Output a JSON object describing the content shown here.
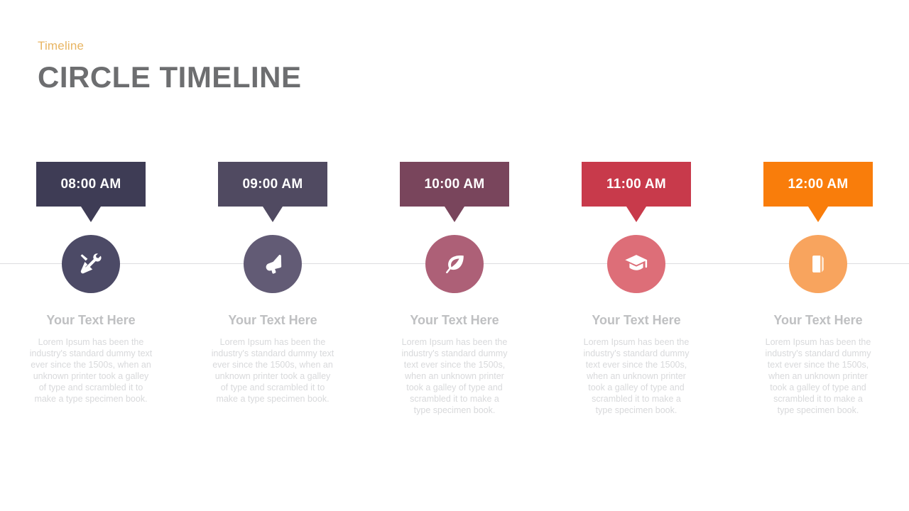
{
  "header": {
    "kicker": "Timeline",
    "title": "CIRCLE TIMELINE",
    "kicker_color": "#E8B563",
    "title_color": "#6D6E70"
  },
  "axis": {
    "color": "#DCDCDF"
  },
  "items": [
    {
      "time": "08:00 AM",
      "heading": "Your Text Here",
      "body": "Lorem Ipsum has been the industry's standard dummy text ever  since the 1500s, when  an  unknown printer took a galley of type and scrambled it to make a type specimen book.",
      "banner_color": "#3E3C55",
      "circle_color": "#4C4A66",
      "icon": "tools-icon"
    },
    {
      "time": "09:00 AM",
      "heading": "Your Text Here",
      "body": "Lorem Ipsum has been the industry's standard dummy text ever  since the 1500s, when  an  unknown printer took a galley of type and scrambled it to make a type specimen book.",
      "banner_color": "#504A61",
      "circle_color": "#625B75",
      "icon": "megaphone-icon"
    },
    {
      "time": "10:00 AM",
      "heading": "Your Text Here",
      "body": "Lorem Ipsum has been the industry's standard dummy text ever  since the 1500s, when  an unknown  printer took a galley of type and scrambled it to make a type specimen book.",
      "banner_color": "#79455C",
      "circle_color": "#AD6077",
      "icon": "leaf-icon"
    },
    {
      "time": "11:00 AM",
      "heading": "Your Text Here",
      "body": "Lorem Ipsum has been the industry's standard dummy text ever  since the 1500s, when  an unknown  printer took a galley of type and scrambled it to make a type specimen book.",
      "banner_color": "#C83A4B",
      "circle_color": "#DD6E78",
      "icon": "graduation-cap-icon"
    },
    {
      "time": "12:00 AM",
      "heading": "Your Text Here",
      "body": "Lorem Ipsum has been the industry's standard dummy text ever  since the 1500s, when  an unknown  printer took a galley of type and scrambled it to make a type specimen book.",
      "banner_color": "#F97D0B",
      "circle_color": "#F8A45E",
      "icon": "book-icon"
    }
  ]
}
